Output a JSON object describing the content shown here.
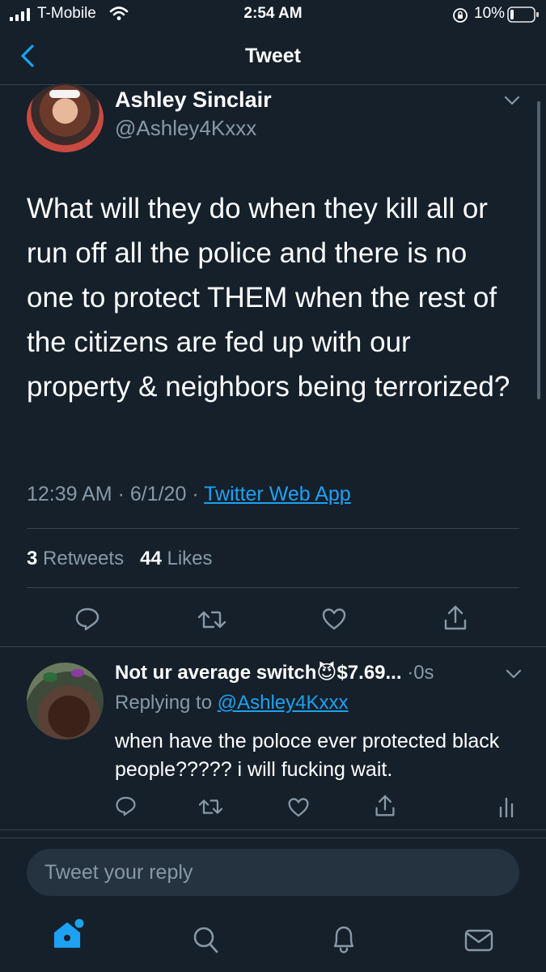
{
  "status": {
    "carrier": "T-Mobile",
    "time": "2:54 AM",
    "battery": "10%"
  },
  "nav": {
    "title": "Tweet"
  },
  "tweet": {
    "author_name": "Ashley Sinclair",
    "author_handle": "@Ashley4Kxxx",
    "text": "What will they do when they kill all or run off all the police and there is no one to protect THEM when the rest of the citizens are fed up with our property & neighbors being terrorized?",
    "time": "12:39 AM",
    "date": "6/1/20",
    "source": "Twitter Web App",
    "retweets_count": "3",
    "retweets_label": "Retweets",
    "likes_count": "44",
    "likes_label": "Likes"
  },
  "reply": {
    "author_name": "Not ur average switch",
    "emoji": "😈",
    "name_suffix": "$7.69...",
    "time": "0s",
    "replying_prefix": "Replying to",
    "replying_handle": "@Ashley4Kxxx",
    "text": "when have the poloce ever protected black people????? i will fucking wait."
  },
  "compose": {
    "placeholder": "Tweet your reply"
  },
  "tabbar": {
    "items": [
      "home-icon",
      "search-icon",
      "notifications-icon",
      "messages-icon"
    ]
  },
  "colors": {
    "background": "#15202b",
    "accent": "#1da1f2",
    "muted": "#8899a6",
    "divider": "#38444d"
  }
}
